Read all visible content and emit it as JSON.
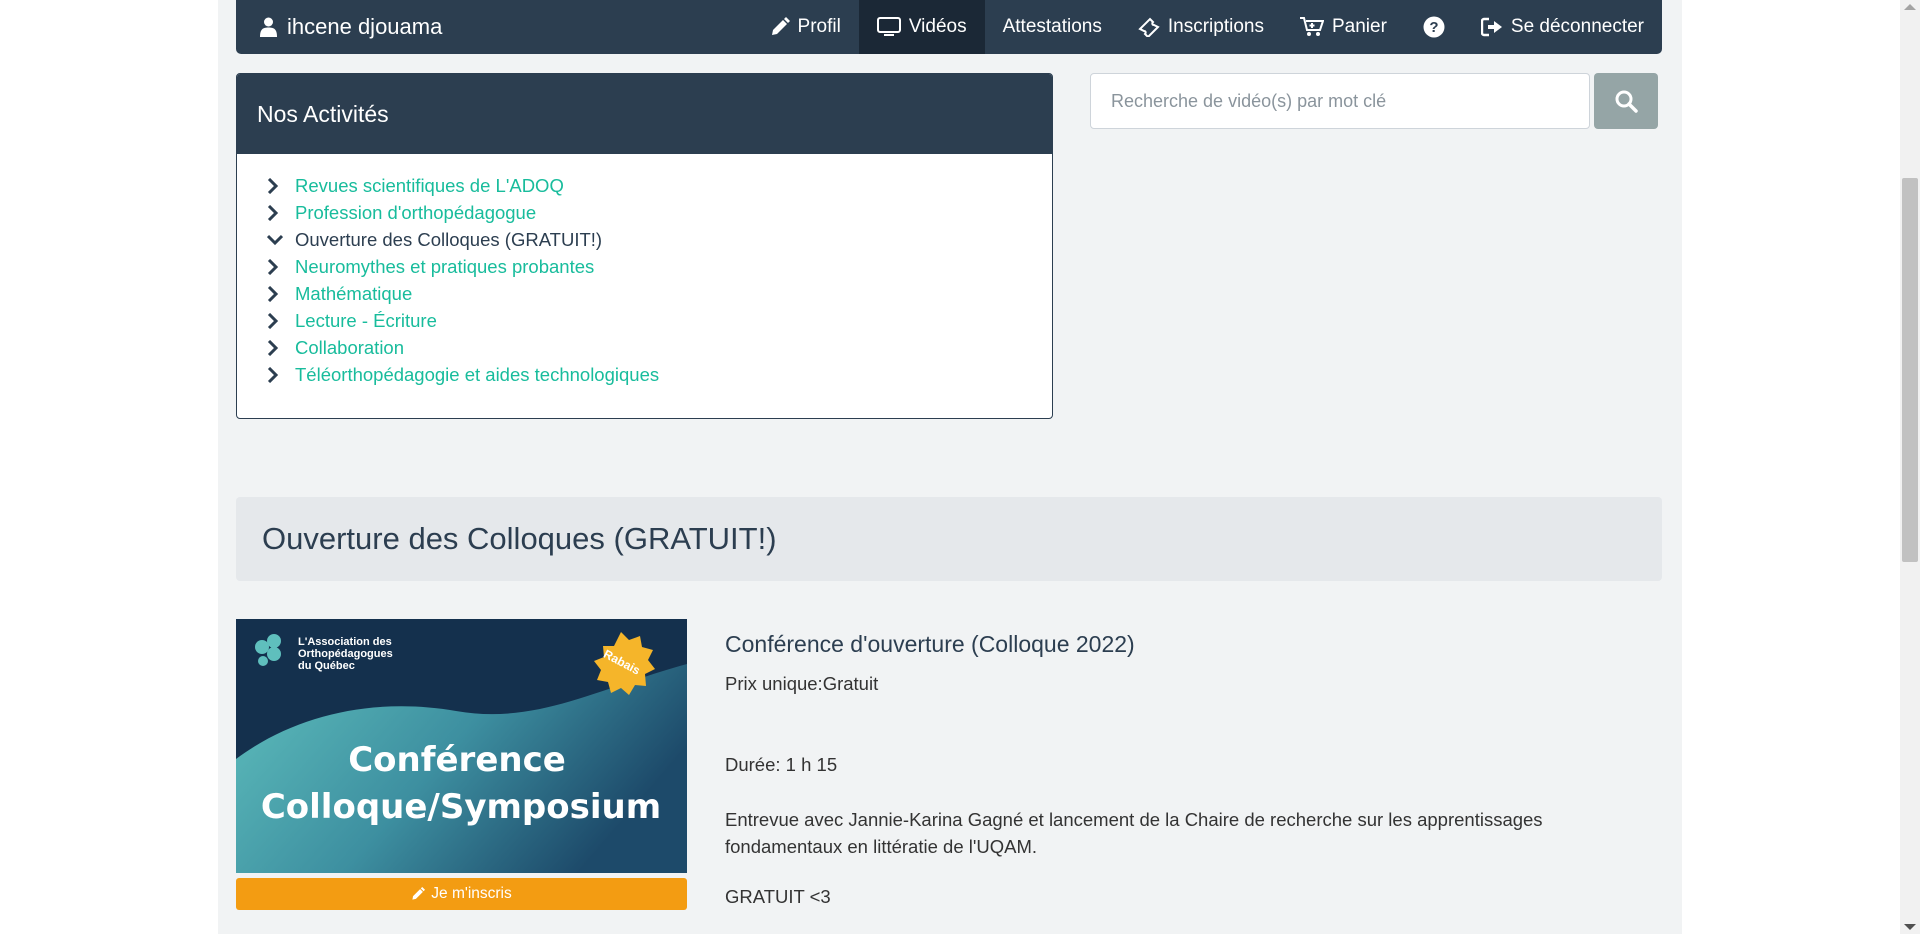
{
  "nav": {
    "user_name": "ihcene djouama",
    "items": [
      {
        "label": "Profil",
        "icon": "pencil-icon"
      },
      {
        "label": "Vidéos",
        "icon": "monitor-icon",
        "active": true
      },
      {
        "label": "Attestations",
        "icon": ""
      },
      {
        "label": "Inscriptions",
        "icon": "ticket-icon"
      },
      {
        "label": "Panier",
        "icon": "cart-icon"
      },
      {
        "label": "",
        "icon": "help-icon"
      },
      {
        "label": "Se déconnecter",
        "icon": "logout-icon"
      }
    ]
  },
  "activities": {
    "title": "Nos Activités",
    "items": [
      {
        "label": "Revues scientifiques de L'ADOQ",
        "open": false
      },
      {
        "label": "Profession d'orthopédagogue",
        "open": false
      },
      {
        "label": "Ouverture des Colloques (GRATUIT!)",
        "open": true
      },
      {
        "label": "Neuromythes et pratiques probantes",
        "open": false
      },
      {
        "label": "Mathématique",
        "open": false
      },
      {
        "label": "Lecture - Écriture",
        "open": false
      },
      {
        "label": "Collaboration",
        "open": false
      },
      {
        "label": "Téléorthopédagogie et aides technologiques",
        "open": false
      }
    ]
  },
  "search": {
    "placeholder": "Recherche de vidéo(s) par mot clé"
  },
  "section": {
    "title": "Ouverture des Colloques (GRATUIT!)"
  },
  "video": {
    "thumbnail": {
      "org_line1": "L'Association des",
      "org_line2": "Orthopédagogues",
      "org_line3": "du Québec",
      "badge": "Rabais",
      "headline1": "Conférence",
      "headline2": "Colloque/Symposium"
    },
    "register_label": "Je m'inscris",
    "title": "Conférence d'ouverture (Colloque 2022)",
    "price": "Prix unique:Gratuit",
    "duration": "Durée: 1 h 15",
    "description": "Entrevue avec Jannie-Karina Gagné et lancement de la Chaire de recherche sur les apprentissages fondamentaux en littératie de l'UQAM.",
    "note": "GRATUIT <3"
  },
  "colors": {
    "navy": "#2c3e50",
    "teal": "#18bc9c",
    "orange": "#f39c12",
    "gray_button": "#95a5a6"
  }
}
